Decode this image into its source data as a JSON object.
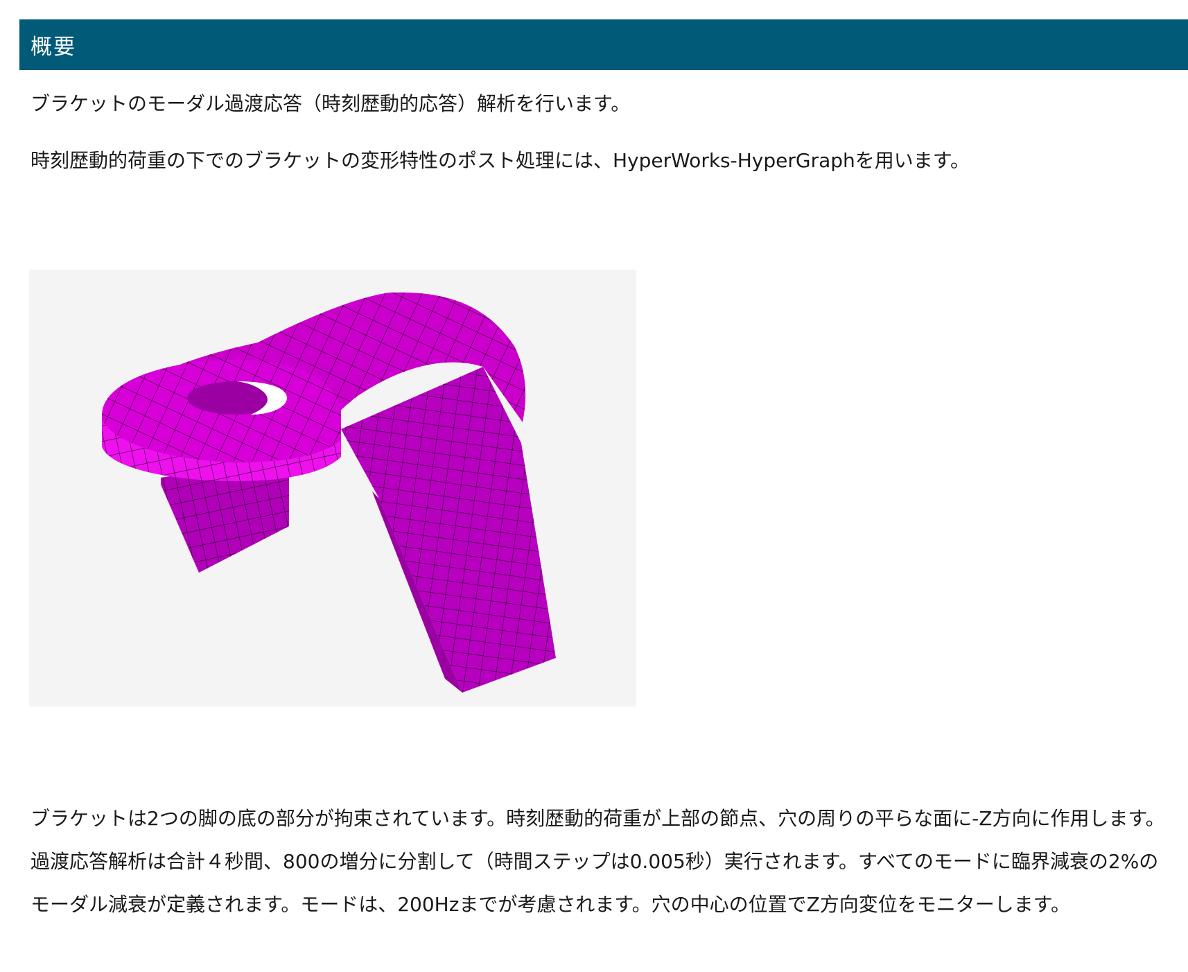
{
  "section": {
    "title": "概要"
  },
  "intro": {
    "line1": "ブラケットのモーダル過渡応答（時刻歴動的応答）解析を行います。",
    "line2": "時刻歴動的荷重の下でのブラケットの変形特性のポスト処理には、HyperWorks-HyperGraphを用います。"
  },
  "figure": {
    "subject": "bracket-mesh-model",
    "colors": {
      "background": "#f4f4f4",
      "mesh_fill": "#cc00cc",
      "mesh_fill_light": "#ee11ee",
      "mesh_fill_dark": "#a000a8",
      "mesh_lines": "#2a002a"
    }
  },
  "description": {
    "text": "ブラケットは2つの脚の底の部分が拘束されています。時刻歴動的荷重が上部の節点、穴の周りの平らな面に-Z方向に作用します。過渡応答解析は合計４秒間、800の増分に分割して（時間ステップは0.005秒）実行されます。すべてのモードに臨界減衰の2%のモーダル減衰が定義されます。モードは、200Hzまでが考慮されます。穴の中心の位置でZ方向変位をモニターします。"
  },
  "colors": {
    "header_bg": "#005a78",
    "header_text": "#ffffff",
    "body_text": "#1a1a1a"
  }
}
